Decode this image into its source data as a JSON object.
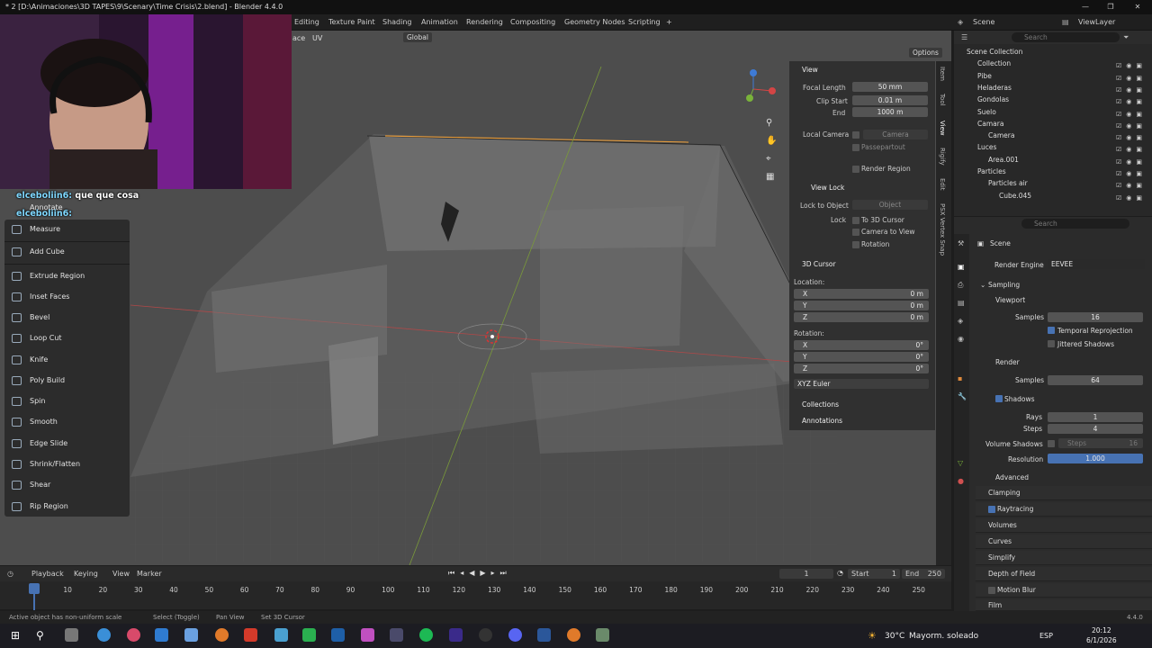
{
  "window": {
    "title": "* 2 [D:\\Animaciones\\3D TAPES\\9\\Scenary\\Time Crisis\\2.blend] - Blender 4.4.0"
  },
  "workspace_tabs": [
    "Editing",
    "Texture Paint",
    "Shading",
    "Animation",
    "Rendering",
    "Compositing",
    "Geometry Nodes",
    "Scripting",
    "+"
  ],
  "topbar_right": {
    "scene": "Scene",
    "viewlayer": "ViewLayer"
  },
  "viewport_header": {
    "face": "ace",
    "uv": "UV",
    "orientation": "Global",
    "options": "Options"
  },
  "chat": [
    {
      "user": "elceboliin6:",
      "msg": "que que cosa"
    },
    {
      "user": "elceboliin6:",
      "msg": ""
    }
  ],
  "toolbar": {
    "items": [
      "Annotate",
      "Measure",
      "Add Cube",
      "Extrude Region",
      "Inset Faces",
      "Bevel",
      "Loop Cut",
      "Knife",
      "Poly Build",
      "Spin",
      "Smooth",
      "Edge Slide",
      "Shrink/Flatten",
      "Shear",
      "Rip Region"
    ]
  },
  "npanel": {
    "view_title": "View",
    "focal_label": "Focal Length",
    "focal": "50 mm",
    "clipstart_label": "Clip Start",
    "clipstart": "0.01 m",
    "end_label": "End",
    "end": "1000 m",
    "localcam_label": "Local Camera",
    "camera": "Camera",
    "passepartout": "Passepartout",
    "render_region": "Render Region",
    "viewlock_title": "View Lock",
    "lock_obj_label": "Lock to Object",
    "object_placeholder": "Object",
    "lock_label": "Lock",
    "to3d": "To 3D Cursor",
    "cam_to_view": "Camera to View",
    "rotation": "Rotation",
    "cursor_title": "3D Cursor",
    "location": "Location:",
    "x": "X",
    "y": "Y",
    "z": "Z",
    "loc_val": "0 m",
    "rotation_label": "Rotation:",
    "rot_val": "0°",
    "euler": "XYZ Euler",
    "collections": "Collections",
    "annotations": "Annotations",
    "tabs": [
      "Item",
      "Tool",
      "View",
      "Rigify",
      "Edit",
      "PSX Vertex Snap"
    ]
  },
  "outliner": {
    "search": "Search",
    "rows": [
      {
        "label": "Scene Collection",
        "indent": 0
      },
      {
        "label": "Collection",
        "indent": 1
      },
      {
        "label": "Pibe",
        "indent": 1
      },
      {
        "label": "Heladeras",
        "indent": 1
      },
      {
        "label": "Gondolas",
        "indent": 1
      },
      {
        "label": "Suelo",
        "indent": 1
      },
      {
        "label": "Camara",
        "indent": 1
      },
      {
        "label": "Camera",
        "indent": 2
      },
      {
        "label": "Luces",
        "indent": 1
      },
      {
        "label": "Area.001",
        "indent": 2
      },
      {
        "label": "Particles",
        "indent": 1
      },
      {
        "label": "Particles air",
        "indent": 2
      },
      {
        "label": "Cube.045",
        "indent": 3
      }
    ]
  },
  "props": {
    "search": "Search",
    "scene": "Scene",
    "engine_label": "Render Engine",
    "engine": "EEVEE",
    "sampling": "Sampling",
    "viewport": "Viewport",
    "samples_label": "Samples",
    "vp_samples": "16",
    "temporal": "Temporal Reprojection",
    "jitter": "Jittered Shadows",
    "render": "Render",
    "r_samples": "64",
    "shadows": "Shadows",
    "rays_label": "Rays",
    "rays": "1",
    "steps_label": "Steps",
    "steps": "4",
    "vol_shadows": "Volume Shadows",
    "vol_steps_label": "Steps",
    "vol_steps": "16",
    "resolution_label": "Resolution",
    "resolution": "1.000",
    "advanced": "Advanced",
    "clamping": "Clamping",
    "raytracing": "Raytracing",
    "volumes": "Volumes",
    "curves": "Curves",
    "simplify": "Simplify",
    "dof": "Depth of Field",
    "motion_blur": "Motion Blur",
    "film": "Film"
  },
  "timeline": {
    "playback": "Playback",
    "keying": "Keying",
    "view": "View",
    "marker": "Marker",
    "frame": "1",
    "start_label": "Start",
    "start": "1",
    "end_label": "End",
    "end": "250",
    "ticks": [
      "1",
      "10",
      "20",
      "30",
      "40",
      "50",
      "60",
      "70",
      "80",
      "90",
      "100",
      "110",
      "120",
      "130",
      "140",
      "150",
      "160",
      "170",
      "180",
      "190",
      "200",
      "210",
      "220",
      "230",
      "240",
      "250"
    ]
  },
  "statusbar": {
    "msg": "Active object has non-uniform scale",
    "select": "Select (Toggle)",
    "pan": "Pan View",
    "cursor": "Set 3D Cursor",
    "version": "4.4.0"
  },
  "taskbar": {
    "weather": "30°C",
    "weather_desc": "Mayorm. soleado",
    "lang": "ESP",
    "time": "20:12",
    "date": "6/1/2026"
  },
  "colors": {
    "accent": "#4772b3",
    "bg": "#1d1d1d",
    "viewport": "#4f4f4f"
  }
}
